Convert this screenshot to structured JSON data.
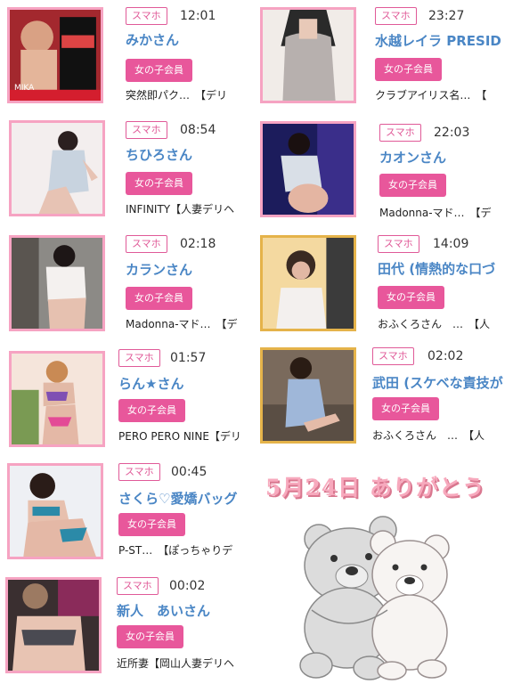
{
  "entries": [
    {
      "badge": "スマホ",
      "time": "12:01",
      "name": "みかさん",
      "member": "女の子会員",
      "shop": "突然即パク…　【デリ",
      "thumb_text": "MIKA"
    },
    {
      "badge": "スマホ",
      "time": "23:27",
      "name": "水越レイラ PRESID",
      "member": "女の子会員",
      "shop": "クラブアイリス名…　【"
    },
    {
      "badge": "スマホ",
      "time": "08:54",
      "name": "ちひろさん",
      "member": "女の子会員",
      "shop": "INFINITY【人妻デリヘ"
    },
    {
      "badge": "スマホ",
      "time": "22:03",
      "name": "カオンさん",
      "member": "女の子会員",
      "shop": "Madonna-マド…　【デ"
    },
    {
      "badge": "スマホ",
      "time": "02:18",
      "name": "カランさん",
      "member": "女の子会員",
      "shop": "Madonna-マド…　【デ"
    },
    {
      "badge": "スマホ",
      "time": "14:09",
      "name": "田代 (情熱的な口づ",
      "member": "女の子会員",
      "shop": "おふくろさん　…　【人"
    },
    {
      "badge": "スマホ",
      "time": "01:57",
      "name": "らん★さん",
      "member": "女の子会員",
      "shop": "PERO PERO NINE【デリ"
    },
    {
      "badge": "スマホ",
      "time": "02:02",
      "name": "武田 (スケベな責技が",
      "member": "女の子会員",
      "shop": "おふくろさん　…　【人"
    },
    {
      "badge": "スマホ",
      "time": "00:45",
      "name": "さくら♡愛嬌バッグ",
      "member": "女の子会員",
      "shop": "P-ST…　【ぽっちゃりデ"
    },
    {
      "badge": "スマホ",
      "time": "00:02",
      "name": "新人　あいさん",
      "member": "女の子会員",
      "shop": "近所妻【岡山人妻デリヘ"
    }
  ],
  "banner": {
    "thanks_text": "5月24日 ありがとう"
  },
  "colors": {
    "accent": "#e8579b",
    "name_blue": "#4a86c5",
    "thumb_border": "#f6a3c2",
    "gold_border": "#e5b34a"
  }
}
